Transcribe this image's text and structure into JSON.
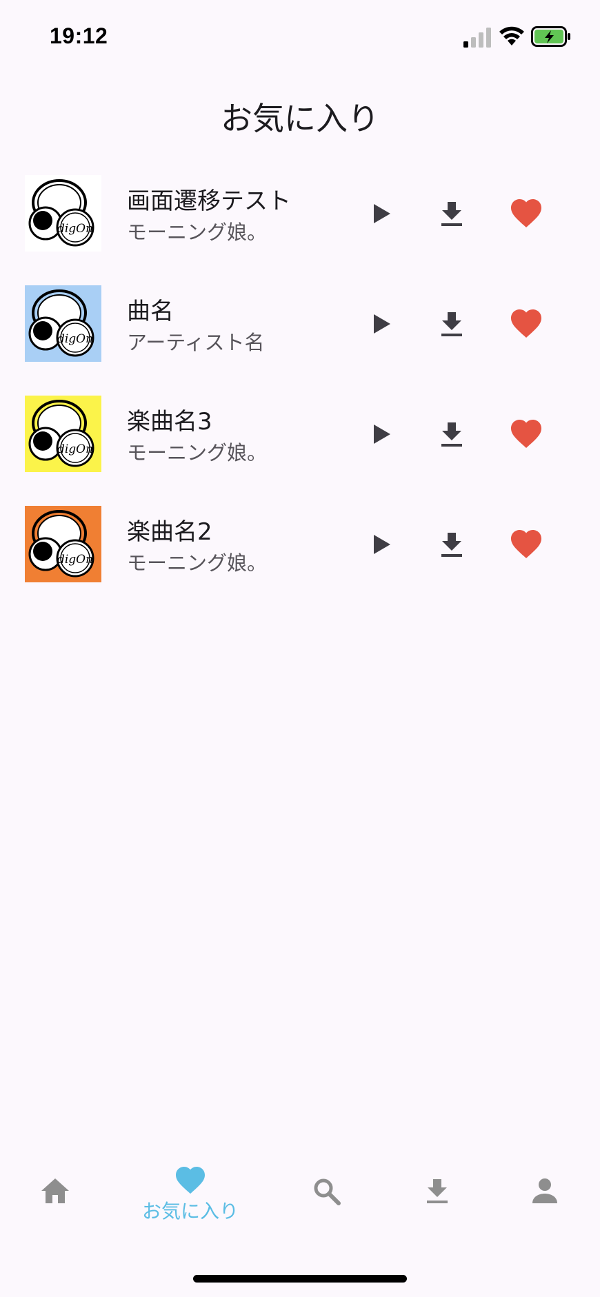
{
  "status_bar": {
    "time": "19:12"
  },
  "header": {
    "title": "お気に入り"
  },
  "songs": [
    {
      "title": "画面遷移テスト",
      "artist": "モーニング娘。",
      "artwork_bg": "#ffffff",
      "artwork_logo": "digOn"
    },
    {
      "title": "曲名",
      "artist": "アーティスト名",
      "artwork_bg": "#a9cff5",
      "artwork_logo": "digOn"
    },
    {
      "title": "楽曲名3",
      "artist": "モーニング娘。",
      "artwork_bg": "#fbf34a",
      "artwork_logo": "digOn"
    },
    {
      "title": "楽曲名2",
      "artist": "モーニング娘。",
      "artwork_bg": "#f07f33",
      "artwork_logo": "digOn"
    }
  ],
  "bottom_nav": {
    "items": [
      {
        "id": "home",
        "icon": "home-icon",
        "label": ""
      },
      {
        "id": "favorites",
        "icon": "heart-icon",
        "label": "お気に入り",
        "active": true
      },
      {
        "id": "search",
        "icon": "search-icon",
        "label": ""
      },
      {
        "id": "downloads",
        "icon": "download-icon",
        "label": ""
      },
      {
        "id": "account",
        "icon": "person-icon",
        "label": ""
      }
    ]
  },
  "colors": {
    "background": "#fcf8fd",
    "accent": "#5bbde4",
    "heart": "#e55442",
    "icon_dark": "#3f3d44",
    "nav_inactive": "#8e8e8e"
  }
}
